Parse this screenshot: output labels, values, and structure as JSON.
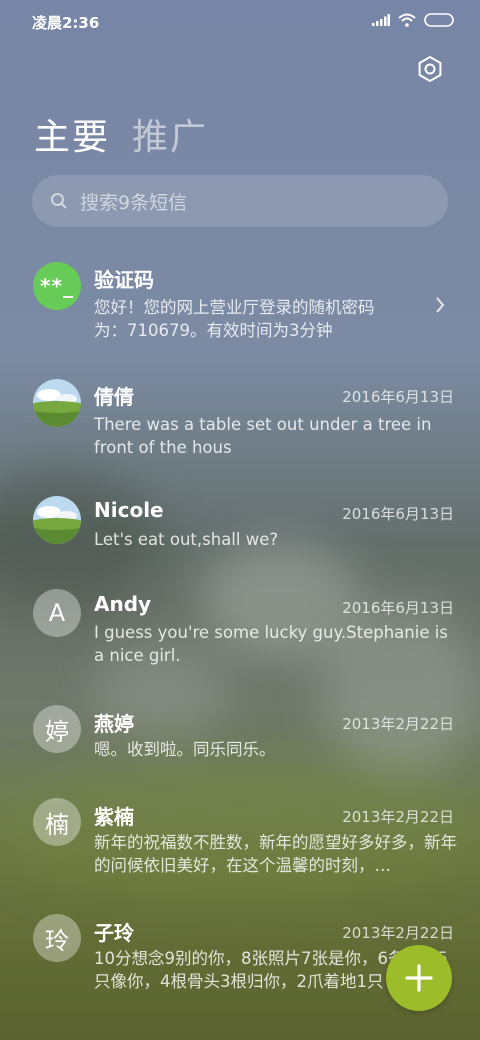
{
  "status_bar": {
    "time": "凌晨2:36"
  },
  "tabs": [
    {
      "label": "主要",
      "active": true
    },
    {
      "label": "推广",
      "active": false
    }
  ],
  "search": {
    "placeholder": "搜索9条短信"
  },
  "messages": [
    {
      "name": "验证码",
      "avatar_text": "**_",
      "date": "",
      "preview": "您好！您的网上营业厅登录的随机密码为：710679。有效时间为3分钟"
    },
    {
      "name": "倩倩",
      "avatar_text": "",
      "date": "2016年6月13日",
      "preview": "There was a table set out under a tree in front of the hous"
    },
    {
      "name": "Nicole",
      "avatar_text": "",
      "date": "2016年6月13日",
      "preview": "Let's eat out,shall we?"
    },
    {
      "name": "Andy",
      "avatar_text": "A",
      "date": "2016年6月13日",
      "preview": "I guess you're some lucky guy.Stephanie is a nice girl."
    },
    {
      "name": "燕婷",
      "avatar_text": "婷",
      "date": "2013年2月22日",
      "preview": "嗯。收到啦。同乐同乐。"
    },
    {
      "name": "紫楠",
      "avatar_text": "楠",
      "date": "2013年2月22日",
      "preview": "新年的祝福数不胜数，新年的愿望好多好多，新年的问候依旧美好，在这个温馨的时刻，…"
    },
    {
      "name": "子玲",
      "avatar_text": "玲",
      "date": "2013年2月22日",
      "preview": "10分想念9别的你，8张照片7张是你，6条短信5只像你，4根骨头3根归你，2爪着地1只"
    }
  ],
  "colors": {
    "fab": "#9dbc2a",
    "verify_avatar": "#67cc57"
  }
}
